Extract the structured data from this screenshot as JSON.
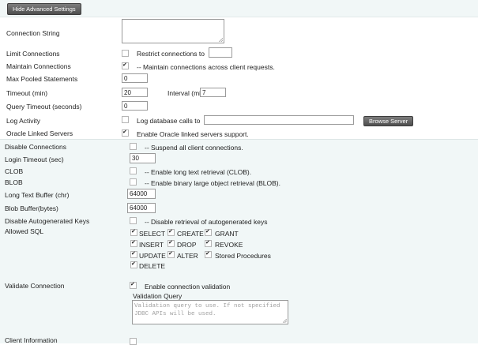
{
  "header": {
    "hide_advanced_button": "Hide Advanced Settings"
  },
  "basic": {
    "connection_string": {
      "label": "Connection String",
      "value": ""
    },
    "limit_connections": {
      "label": "Limit Connections",
      "checked": false,
      "restrict_label": "Restrict connections to",
      "value": ""
    },
    "maintain_connections": {
      "label": "Maintain Connections",
      "checked": true,
      "desc": "-- Maintain connections across client requests."
    },
    "max_pooled_statements": {
      "label": "Max Pooled Statements",
      "value": "0"
    },
    "timeout": {
      "label": "Timeout (min)",
      "value": "20",
      "interval_label": "Interval (min)",
      "interval_value": "7"
    },
    "query_timeout": {
      "label": "Query Timeout (seconds)",
      "value": "0"
    },
    "log_activity": {
      "label": "Log Activity",
      "checked": false,
      "desc": "Log database calls to",
      "value": "",
      "browse_button": "Browse Server"
    },
    "oracle_linked_servers": {
      "label": "Oracle Linked Servers",
      "checked": true,
      "desc": "Enable Oracle linked servers support."
    }
  },
  "advanced": {
    "disable_connections": {
      "label": "Disable Connections",
      "checked": false,
      "desc": "-- Suspend all client connections."
    },
    "login_timeout": {
      "label": "Login Timeout (sec)",
      "value": "30"
    },
    "clob": {
      "label": "CLOB",
      "checked": false,
      "desc": "-- Enable long text retrieval (CLOB)."
    },
    "blob": {
      "label": "BLOB",
      "checked": false,
      "desc": "-- Enable binary large object retrieval (BLOB)."
    },
    "long_text_buffer": {
      "label": "Long Text Buffer (chr)",
      "value": "64000"
    },
    "blob_buffer": {
      "label": "Blob Buffer(bytes)",
      "value": "64000"
    },
    "disable_autogenerated_keys": {
      "label": "Disable Autogenerated Keys",
      "checked": false,
      "desc": "-- Disable retrieval of autogenerated keys"
    },
    "allowed_sql": {
      "label": "Allowed SQL",
      "options": [
        {
          "label": "SELECT",
          "checked": true
        },
        {
          "label": "CREATE",
          "checked": true
        },
        {
          "label": "GRANT",
          "checked": true
        },
        {
          "label": "INSERT",
          "checked": true
        },
        {
          "label": "DROP",
          "checked": true
        },
        {
          "label": "REVOKE",
          "checked": true
        },
        {
          "label": "UPDATE",
          "checked": true
        },
        {
          "label": "ALTER",
          "checked": true
        },
        {
          "label": "Stored Procedures",
          "checked": true
        },
        {
          "label": "DELETE",
          "checked": true
        }
      ]
    },
    "validate_connection": {
      "label": "Validate Connection",
      "checked": true,
      "desc": "Enable connection validation",
      "query_label": "Validation Query",
      "query_placeholder": "Validation query to use. If not specified\nJDBC APIs will be used."
    },
    "client_information": {
      "label": "Client Information"
    }
  }
}
